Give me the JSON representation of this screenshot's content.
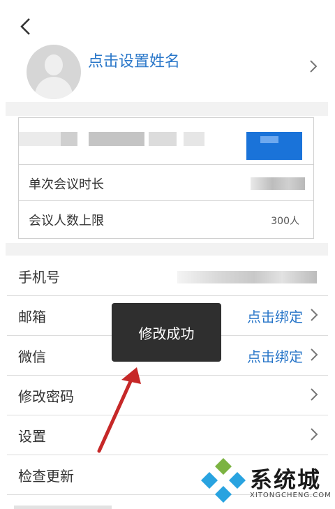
{
  "header": {
    "back_icon": "chevron-left-icon"
  },
  "profile": {
    "name_label": "点击设置姓名",
    "avatar_icon": "person-silhouette-icon"
  },
  "card": {
    "rows": [
      {
        "label": "单次会议时长",
        "value": ""
      },
      {
        "label": "会议人数上限",
        "value": "300人"
      }
    ]
  },
  "list": {
    "items": [
      {
        "label": "手机号",
        "action": ""
      },
      {
        "label": "邮箱",
        "action": "点击绑定"
      },
      {
        "label": "微信",
        "action": "点击绑定"
      },
      {
        "label": "修改密码",
        "action": ""
      },
      {
        "label": "设置",
        "action": ""
      },
      {
        "label": "检查更新",
        "action": ""
      }
    ]
  },
  "toast": {
    "text": "修改成功"
  },
  "watermark": {
    "name_cn": "系统城",
    "name_en": "XITONGCHENG.COM"
  },
  "colors": {
    "accent": "#2a77c9",
    "button": "#1a73d9",
    "toast_bg": "#2f2f2f",
    "arrow": "#c62828"
  }
}
